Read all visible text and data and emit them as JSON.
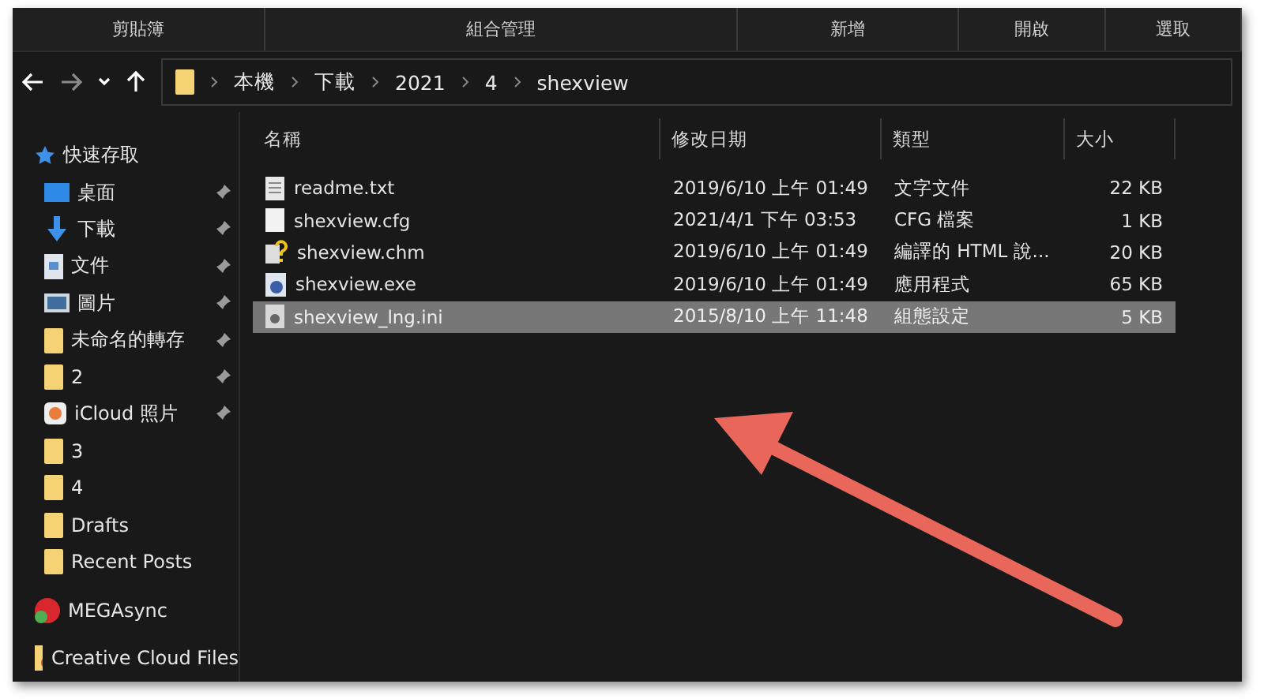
{
  "ribbon_groups": [
    "剪貼簿",
    "組合管理",
    "新增",
    "開啟",
    "選取"
  ],
  "address_bar": {
    "path": [
      "本機",
      "下載",
      "2021",
      "4",
      "shexview"
    ]
  },
  "sidebar": {
    "quick_access": "快速存取",
    "items": [
      {
        "label": "桌面",
        "kind": "desktop",
        "pinned": true
      },
      {
        "label": "下載",
        "kind": "download",
        "pinned": true
      },
      {
        "label": "文件",
        "kind": "document",
        "pinned": true
      },
      {
        "label": "圖片",
        "kind": "picture",
        "pinned": true
      },
      {
        "label": "未命名的轉存",
        "kind": "folder",
        "pinned": true
      },
      {
        "label": "2",
        "kind": "folder",
        "pinned": true
      },
      {
        "label": "iCloud 照片",
        "kind": "photos",
        "pinned": true
      },
      {
        "label": "3",
        "kind": "folder",
        "pinned": false
      },
      {
        "label": "4",
        "kind": "folder",
        "pinned": false
      },
      {
        "label": "Drafts",
        "kind": "folder",
        "pinned": false
      },
      {
        "label": "Recent Posts",
        "kind": "folder",
        "pinned": false
      }
    ],
    "roots": [
      {
        "label": "MEGAsync",
        "kind": "mega"
      },
      {
        "label": "Creative Cloud Files",
        "kind": "cloud"
      }
    ]
  },
  "table": {
    "columns": [
      "名稱",
      "修改日期",
      "類型",
      "大小"
    ],
    "rows": [
      {
        "name": "readme.txt",
        "kind": "text",
        "date": "2019/6/10 上午 01:49",
        "type": "文字文件",
        "size": "22 KB",
        "selected": false
      },
      {
        "name": "shexview.cfg",
        "kind": "blank",
        "date": "2021/4/1 下午 03:53",
        "type": "CFG 檔案",
        "size": "1 KB",
        "selected": false
      },
      {
        "name": "shexview.chm",
        "kind": "help",
        "date": "2019/6/10 上午 01:49",
        "type": "編譯的 HTML 說...",
        "size": "20 KB",
        "selected": false
      },
      {
        "name": "shexview.exe",
        "kind": "app",
        "date": "2019/6/10 上午 01:49",
        "type": "應用程式",
        "size": "65 KB",
        "selected": false
      },
      {
        "name": "shexview_lng.ini",
        "kind": "settings",
        "date": "2015/8/10 上午 11:48",
        "type": "組態設定",
        "size": "5 KB",
        "selected": true
      }
    ]
  }
}
